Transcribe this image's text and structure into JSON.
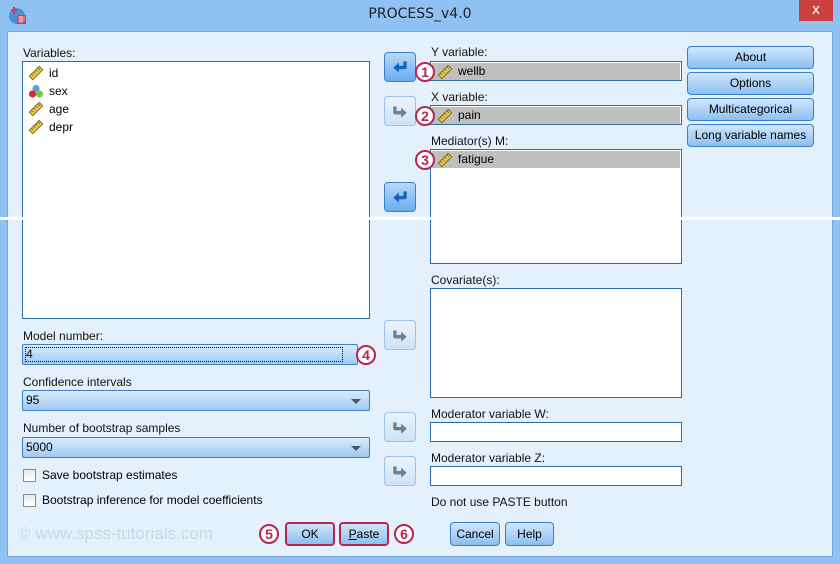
{
  "window": {
    "title": "PROCESS_v4.0",
    "close_label": "x"
  },
  "variables": {
    "label": "Variables:",
    "items": [
      {
        "name": "id",
        "type": "scale"
      },
      {
        "name": "sex",
        "type": "nominal"
      },
      {
        "name": "age",
        "type": "scale"
      },
      {
        "name": "depr",
        "type": "scale"
      }
    ]
  },
  "y_variable": {
    "label": "Y variable:",
    "value": "wellb",
    "badge": "1"
  },
  "x_variable": {
    "label": "X variable:",
    "value": "pain",
    "badge": "2"
  },
  "mediators": {
    "label": "Mediator(s) M:",
    "items": [
      "fatigue"
    ],
    "badge": "3"
  },
  "covariates": {
    "label": "Covariate(s):",
    "items": []
  },
  "moderator_w": {
    "label": "Moderator variable W:",
    "value": ""
  },
  "moderator_z": {
    "label": "Moderator variable Z:",
    "value": ""
  },
  "note": "Do not use PASTE button",
  "side_buttons": {
    "about": "About",
    "options": "Options",
    "multicategorical": "Multicategorical",
    "long_names": "Long variable names"
  },
  "model_number": {
    "label": "Model number:",
    "value": "4",
    "badge": "4"
  },
  "confidence_intervals": {
    "label": "Confidence intervals",
    "value": "95"
  },
  "bootstrap_samples": {
    "label": "Number of bootstrap samples",
    "value": "5000"
  },
  "checkboxes": {
    "save_bootstrap": {
      "label": "Save bootstrap estimates",
      "checked": false
    },
    "bootstrap_inference": {
      "label": "Bootstrap inference for model coefficients",
      "checked": false
    }
  },
  "buttons": {
    "ok": "OK",
    "paste_accel": "P",
    "paste_rest": "aste",
    "cancel": "Cancel",
    "help": "Help",
    "ok_badge": "5",
    "paste_badge": "6"
  },
  "watermark": "© www.spss-tutorials.com",
  "colors": {
    "accent": "#3c7fc4",
    "badge": "#b8254d",
    "close": "#c9413e",
    "selected_item": "#bfbfbf"
  }
}
